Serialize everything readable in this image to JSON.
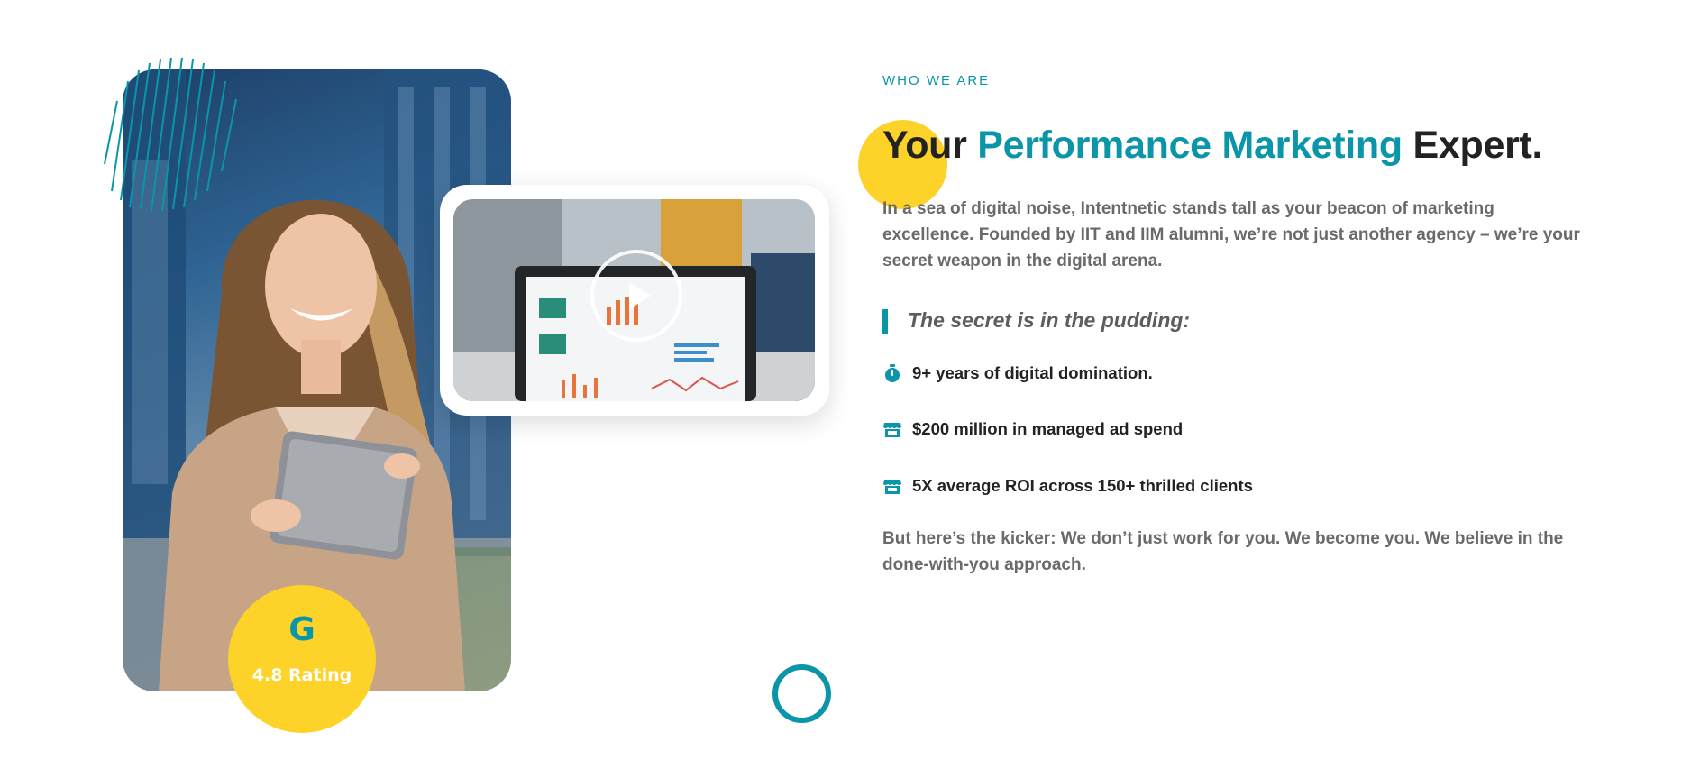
{
  "section": {
    "eyebrow": "WHO WE ARE",
    "headline": {
      "lead": "Your ",
      "accent": "Performance Marketing",
      "tail": " Expert."
    },
    "intro": "In a sea of digital noise, Intentnetic stands tall as your beacon of marketing excellence. Founded by IIT and IIM alumni, we’re not just another agency – we’re your secret weapon in the digital arena.",
    "quote": "The secret is in the pudding:",
    "features": [
      {
        "icon": "stopwatch-icon",
        "label": "9+ years of digital domination."
      },
      {
        "icon": "store-icon",
        "label": "$200 million in managed ad spend"
      },
      {
        "icon": "store-icon",
        "label": "5X average ROI across 150+ thrilled clients"
      }
    ],
    "outro": "But here’s the kicker: We don’t just work for you. We become you. We believe in the done-with-you approach."
  },
  "rating": {
    "icon": "google-icon",
    "letter": "G",
    "text": "4.8 Rating"
  },
  "video": {
    "play_icon": "play-icon"
  },
  "colors": {
    "accent": "#0b95a8",
    "highlight": "#fdd32a",
    "heading": "#222222",
    "body": "#6a6a6a"
  }
}
